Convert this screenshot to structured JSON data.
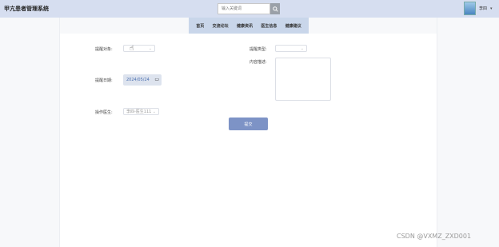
{
  "app": {
    "title": "甲亢患者管理系统"
  },
  "search": {
    "placeholder": "输入关键词"
  },
  "user": {
    "name": "李四"
  },
  "nav": [
    "首页",
    "交流论坛",
    "健康资讯",
    "医生信息",
    "健康建议"
  ],
  "form": {
    "target_label": "提醒对象:",
    "type_label": "提醒类型:",
    "content_label": "内容描述:",
    "date_label": "提醒日期:",
    "date_value": "2024/05/24",
    "operator_label": "操作医生:",
    "operator_value": "李四-医生111",
    "submit_label": "提交"
  },
  "watermark": "CSDN @VXMZ_ZXD001"
}
